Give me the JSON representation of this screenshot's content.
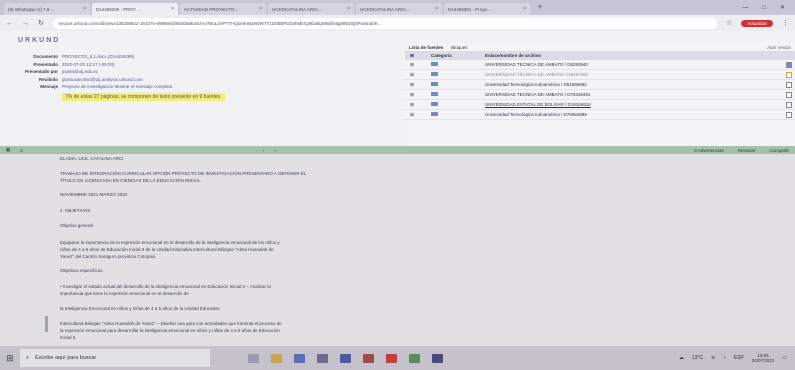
{
  "tabs": [
    {
      "label": "(9) Whatsapp (1) 7.9 ... "
    },
    {
      "label": "D14458299 - PROY ..."
    },
    {
      "label": "ACTIVIDAD PROYECTO..."
    },
    {
      "label": "UCEDCATALINA ARCI..."
    },
    {
      "label": "UCEDCATALINA ARCI..."
    },
    {
      "label": "D14458301 - Proye..."
    }
  ],
  "window_controls": {
    "minimize": "—",
    "maximize": "□",
    "close": "✕"
  },
  "address": {
    "url": "secure.urkund.com/old/view/135208622-164275-699656@9bd0a6Ea57Av7BuLaYPTTHQdHKINaN0WTY1D05BPDDvhMbrQ9DaltgWBdhr6gl8NDtQsPswtnd0K...",
    "activate_label": "Actualizar"
  },
  "app": {
    "brand": "URKUND",
    "meta": [
      {
        "label": "Documento",
        "value": "PROYECTO_5.1.docx (D14458299)"
      },
      {
        "label": "Presentado",
        "value": "2022-07-20 12:17 (-05:00)"
      },
      {
        "label": "Presentado por",
        "value": "jnuela@utj.edu.ec"
      },
      {
        "label": "Recibido",
        "value": "gloria.sanchez@utj.analysis.urkund.com"
      },
      {
        "label": "Mensaje",
        "value": "Proyecto de investigación  Mostrar el mensaje completo"
      }
    ],
    "similarity_note": "7% de estas 27 páginas, se componen de texto presente en 9 fuentes.",
    "sources": {
      "tab1": "Lista de fuentes",
      "tab2": "Bloques",
      "expand_label": "Abrir sesión",
      "head_cat": "Categoría",
      "head_name": "Enlace/nombre de archivo",
      "rows": [
        {
          "name": "UNIVERSIDAD TECNICA DE AMBATO / D8283940"
        },
        {
          "name": "UNIVERSIDAD TECNICA DE AMBATO / D8267582"
        },
        {
          "name": "Universidad Tecnológica Indoamérica / D51556992"
        },
        {
          "name": "UNIVERSIDAD TECNICA DE AMBATO / D76348481"
        },
        {
          "name": "UNIVERSIDAD ESTATAL DE BOLIVAR / D19346916"
        },
        {
          "name": "Universidad Tecnológica Indoamérica / D76884989"
        }
      ]
    }
  },
  "toolbar": {
    "prev": "‹",
    "next": "›",
    "warnings": "0 Advertencias",
    "reset": "Reiniciar",
    "share": "Compartir"
  },
  "document": {
    "lines": [
      "ELADIA. UCE. CATALINA ARCI",
      "TRABAJO DE INTEGRACIÓN CURRICULAR OPCIÓN PROYECTO DE INVESTIGACIÓN PRESENTADO A OBTENER EL",
      "TÍTULO DE LICENCIADA EN CIENCIAS DE LA EDUCACIÓN INICIAL",
      "NOVIEMBRE 2021-MARZO 2022",
      "2. OBJETIVOS",
      "Objetivo general",
      "Equiparar la importancia de la expresión emocional en el desarrollo de la inteligencia emocional de los niños y",
      "niñas de 4 a 5 años de Educación Inicial II de la Unidad Educativa Intercultural Bilingüe \"Alma Huasulah de",
      "Yanez\" del Cantón Saraguro provincia Cotopaxi.",
      "Objetivos específicos",
      "• Investigar el estado actual del desarrollo de la inteligencia emocional en Educación Inicial II – Analizar la",
      "importancia que tiene la expresión emocional en el desarrollo de",
      "la Inteligencia Emocional en niños y niñas de 4 a 5 años de la Unidad Educativa",
      "Intercultural Bilingüe \"Alma Huasulah de Yanez\" – Diseñar una guía con actividades que fomenta el proceso de",
      "la expresión emocional para desarrollar la inteligencia emocional en niños y niñas de 4 a 5 años de Educación",
      "Inicial II."
    ]
  },
  "taskbar": {
    "search_placeholder": "Escribe aquí para buscar",
    "weather": "13°C",
    "time": "13:06",
    "date": "20/07/2022",
    "lang": "ESP"
  }
}
